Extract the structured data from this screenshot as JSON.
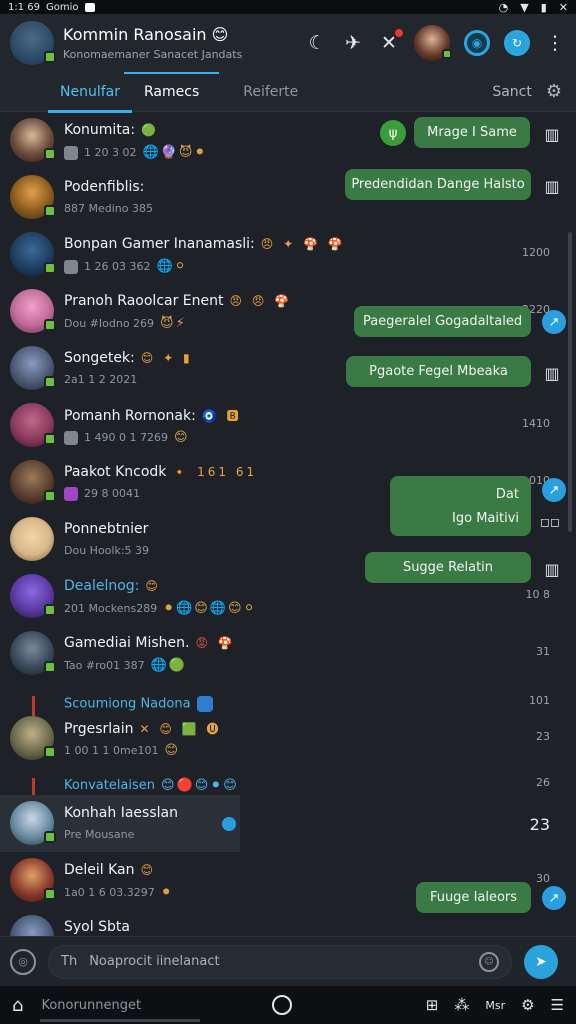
{
  "status_bar": {
    "time": "1:1 69",
    "carrier": "Gomio"
  },
  "header": {
    "title": "Kommin Ranosain",
    "title_emoji": "😊",
    "subtitle": "Konomaemaner Sanacet Jandats"
  },
  "tabs": [
    {
      "label": "Nenulfar"
    },
    {
      "label": "Ramecs"
    },
    {
      "label": "Reiferte"
    }
  ],
  "search_label": "Sanct",
  "chats": [
    {
      "name": "Konumita:",
      "emoji": "🟢",
      "sub": "1 20 3 02",
      "sub_icons": "🌐🔮😈⚫",
      "time": "",
      "avatar_color": "#6b4a3a"
    },
    {
      "name": "Podenfiblis:",
      "emoji": "",
      "sub": "887 Medino 385",
      "sub_icons": "",
      "time": "",
      "avatar_color": "#b8862e"
    },
    {
      "name": "Bonpan Gamer Inanamasli:",
      "emoji": "😠 ✦ 🍄 🍄",
      "sub": "1 26 03 362",
      "sub_icons": "🌐⚪",
      "time": "1200",
      "avatar_color": "#2f5a86"
    },
    {
      "name": "Pranoh Raoolcar Enent",
      "emoji": "😠 😠 🍄",
      "sub": "Dou #Iodno 269",
      "sub_icons": "😈⚡",
      "time": "2220",
      "avatar_color": "#c06a9a"
    },
    {
      "name": "Songetek:",
      "emoji": "😊 ✦ ▮",
      "sub": "2a1 1 2 2021",
      "sub_icons": "",
      "time": "",
      "avatar_color": "#4d5a74"
    },
    {
      "name": "Pomanh Rornonak:",
      "emoji": "🧿 🅱",
      "sub": "1 490 0 1 7269",
      "sub_icons": "😊",
      "time": "1410",
      "avatar_color": "#8a3a5a"
    },
    {
      "name": "Paakot Kncodk",
      "emoji": "🔸 161 61",
      "sub": "29 8 0041",
      "sub_icons": "",
      "time": "010",
      "avatar_color": "#5a4030"
    },
    {
      "name": "Ponnebtnier",
      "emoji": "",
      "sub": "Dou Hoolk:5 39",
      "sub_icons": "",
      "time": "",
      "avatar_color": "#d6b78a"
    },
    {
      "name": "Dealelnog:",
      "emoji": "😊",
      "sub": "201 Mockens289",
      "sub_icons": "⚫🌐😊🌐😊⚪",
      "time": "10 8",
      "avatar_color": "#5a3aa0"
    },
    {
      "name": "Gamediai Mishen.",
      "emoji": "😡 🍄",
      "sub": "Tao #ro01 387",
      "sub_icons": "🌐🟢",
      "time": "31",
      "avatar_color": "#3a4a5a"
    },
    {
      "name": "Prgesrlain",
      "emoji": "✕ 😊 🟩 🅤",
      "sub": "1 00 1 1 0me101",
      "sub_icons": "😊",
      "time": "23",
      "avatar_color": "#6a6a4a"
    },
    {
      "name": "Konhah Iaesslan",
      "emoji": "🔵",
      "sub": "Pre Mousane",
      "sub_icons": "",
      "time": "23",
      "avatar_color": "#6a8aa0"
    },
    {
      "name": "Deleil Kan",
      "emoji": "😊",
      "sub": "1a0 1 6 03.3297",
      "sub_icons": "⚫",
      "time": "30",
      "avatar_color": "#8a3a2a"
    },
    {
      "name": "Syol Sbta",
      "emoji": "",
      "sub": "",
      "sub_icons": "",
      "time": "",
      "avatar_color": "#4a5a7a"
    }
  ],
  "inline_labels": [
    {
      "text": "Scoumiong Nadona",
      "time": "101"
    },
    {
      "text": "Konvatelaisen",
      "emojis": "😊🔴😊⚫😊",
      "time": "26"
    }
  ],
  "bubbles": [
    {
      "text": "Mrage I Same"
    },
    {
      "text": "Predendidan Dange Halsto"
    },
    {
      "text": "Paegeralel Gogadaltaled"
    },
    {
      "text": "Pgaote Fegel Mbeaka"
    },
    {
      "text_top": "Dat",
      "text_bottom": "Igo Maitivi"
    },
    {
      "text": "Sugge Relatin"
    },
    {
      "text": "Fuuge Ialeors"
    }
  ],
  "composer": {
    "placeholder": "Noaprocit iinelanact",
    "prefix": "Th"
  },
  "navbar": {
    "label": "Konorunnenget",
    "right_label": "Msr"
  }
}
